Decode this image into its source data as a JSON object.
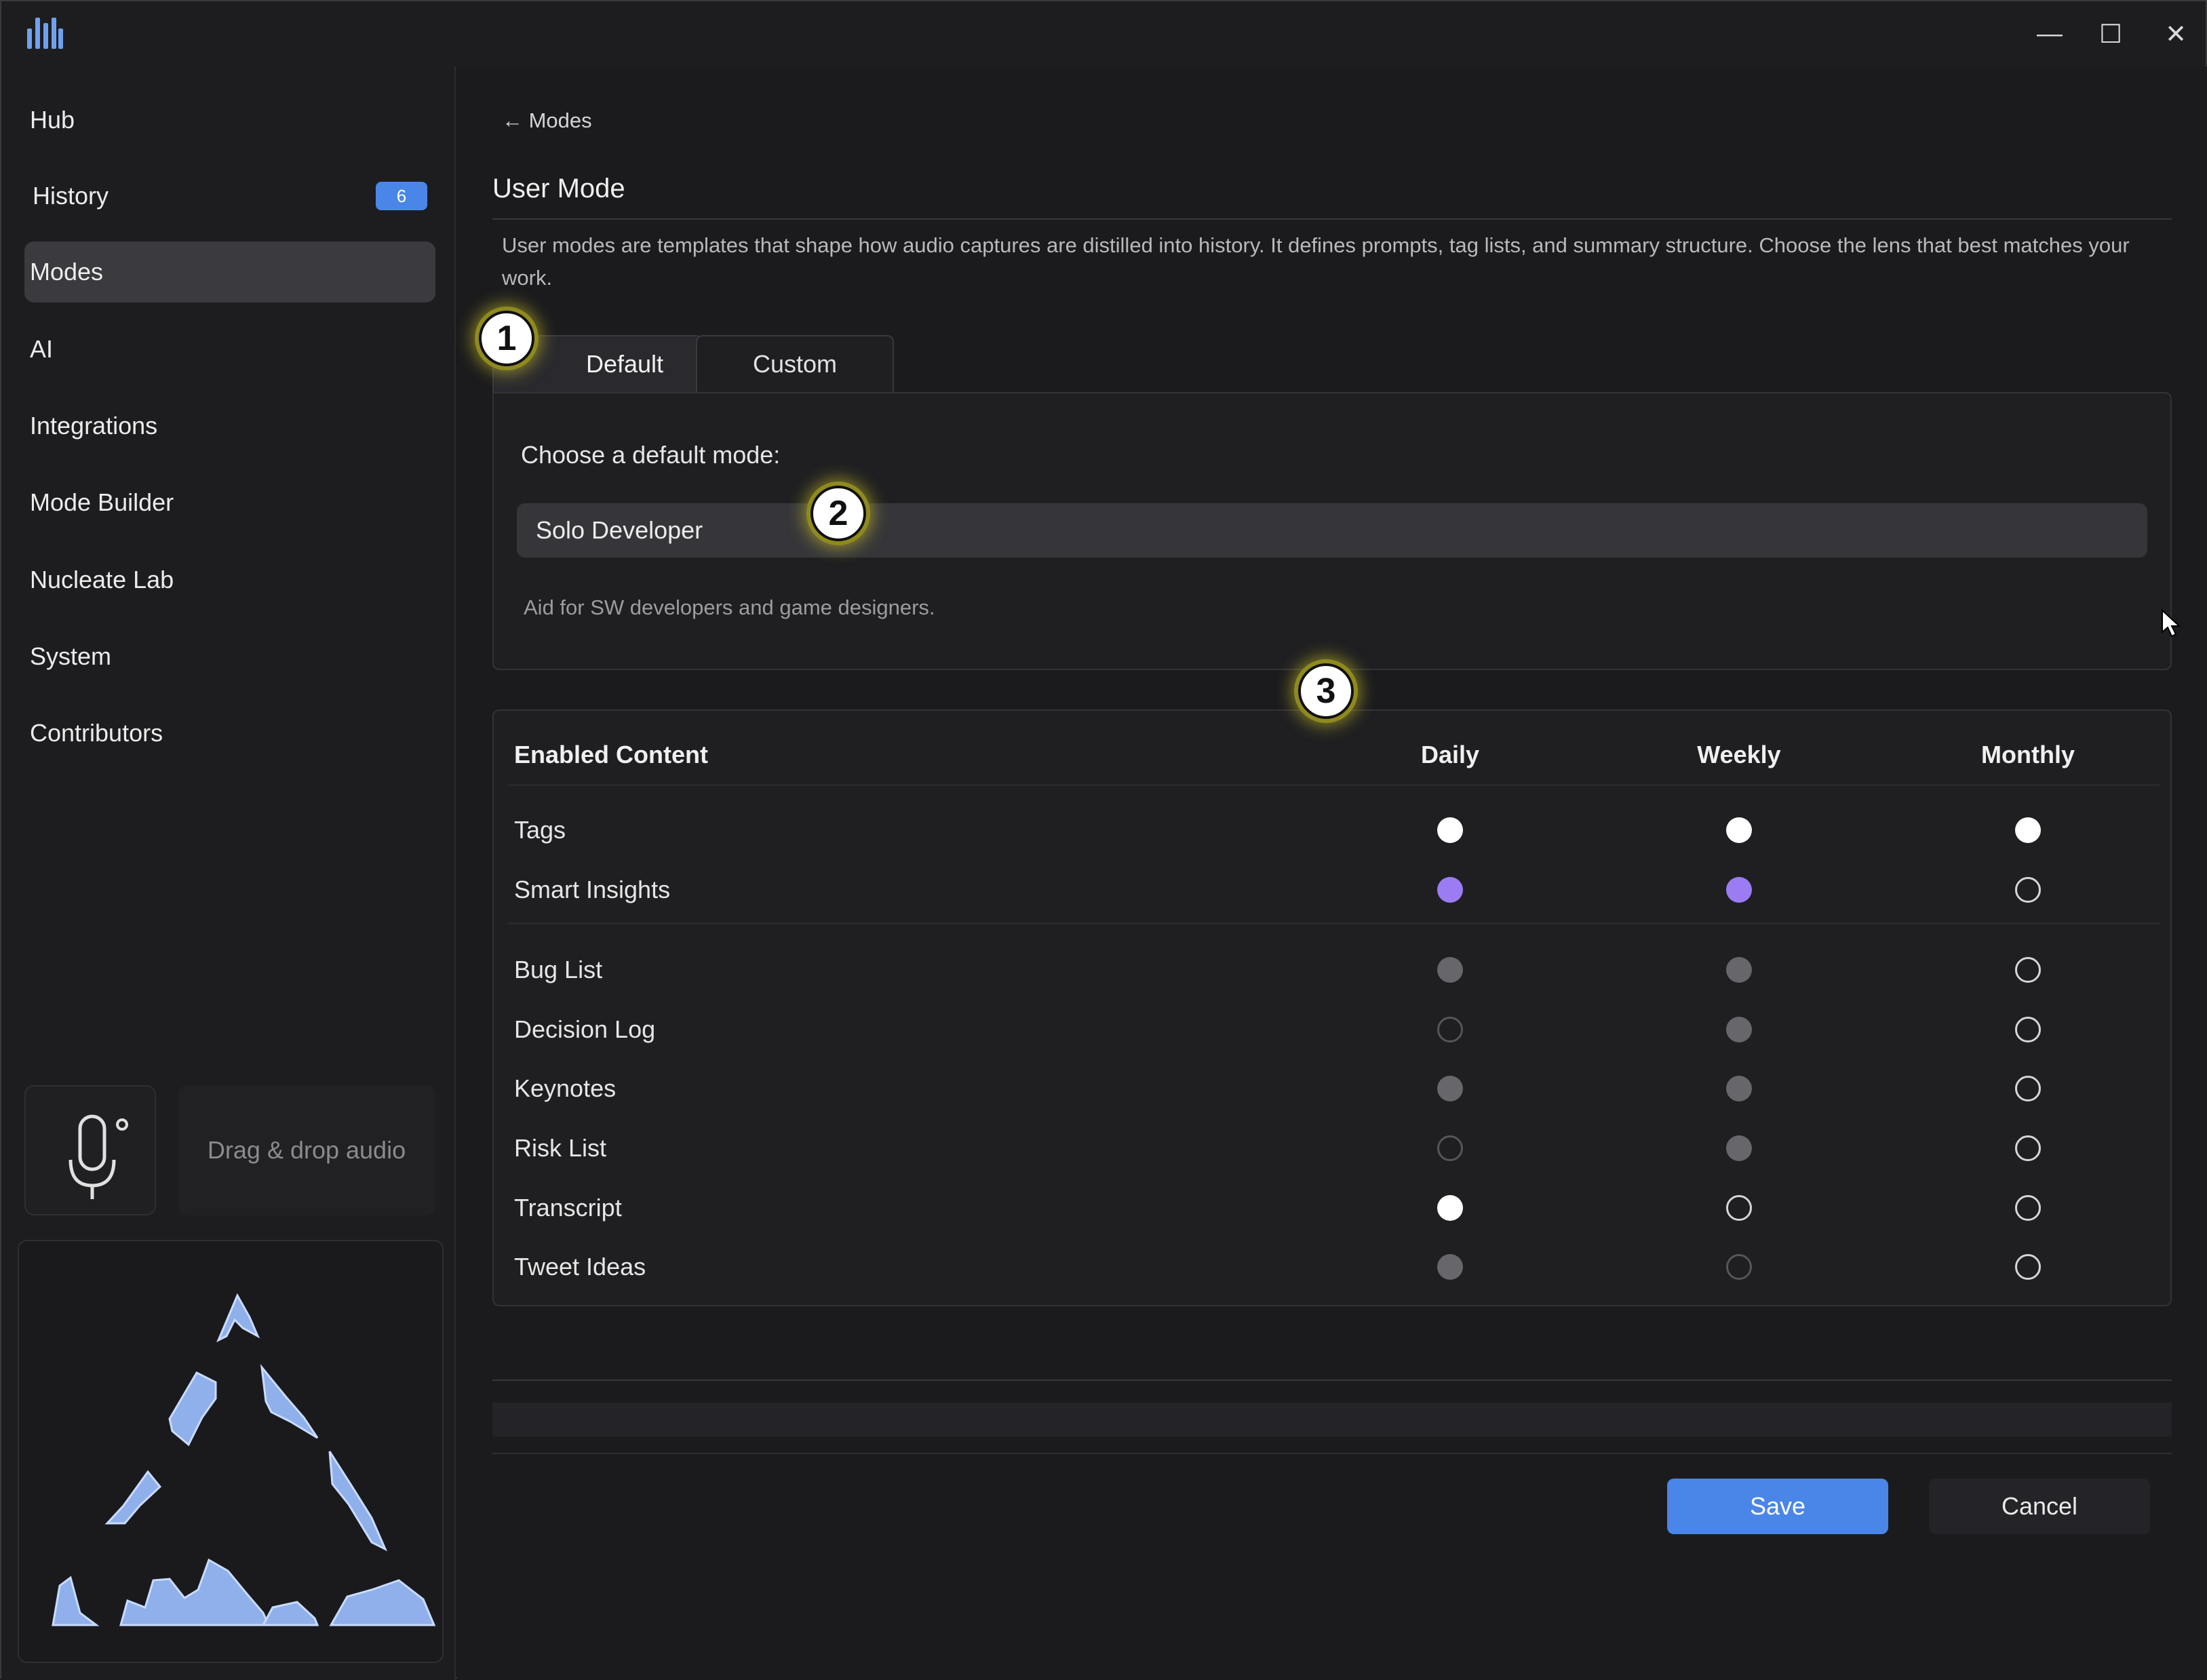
{
  "window": {
    "minimize_glyph": "—",
    "maximize_glyph": "☐",
    "close_glyph": "✕"
  },
  "sidebar": {
    "items": [
      {
        "label": "Hub"
      },
      {
        "label": "History",
        "badge": "6"
      },
      {
        "label": "Modes",
        "active": true
      },
      {
        "label": "AI"
      },
      {
        "label": "Integrations"
      },
      {
        "label": "Mode Builder"
      },
      {
        "label": "Nucleate Lab"
      },
      {
        "label": "System"
      },
      {
        "label": "Contributors"
      }
    ],
    "drop_label": "Drag & drop audio"
  },
  "main": {
    "back_link": "← Modes",
    "title": "User Mode",
    "description": "User modes are templates that shape how audio captures are distilled into history. It defines prompts, tag lists, and summary structure. Choose the lens that best matches your work.",
    "tabs": [
      {
        "label": "Default",
        "active": true
      },
      {
        "label": "Custom",
        "active": false
      }
    ],
    "panel": {
      "label": "Choose a default mode:",
      "selected_mode": "Solo Developer",
      "mode_description": "Aid for SW developers and game designers."
    },
    "table": {
      "headers": [
        "Enabled Content",
        "Daily",
        "Weekly",
        "Monthly"
      ],
      "rows": [
        {
          "label": "Tags",
          "states": [
            "white",
            "white",
            "white"
          ]
        },
        {
          "label": "Smart Insights",
          "states": [
            "purple",
            "purple",
            "outline"
          ]
        },
        {
          "label": "Bug List",
          "states": [
            "gray",
            "gray",
            "outline"
          ]
        },
        {
          "label": "Decision Log",
          "states": [
            "dim",
            "gray",
            "outline"
          ]
        },
        {
          "label": "Keynotes",
          "states": [
            "gray",
            "gray",
            "outline"
          ]
        },
        {
          "label": "Risk List",
          "states": [
            "dim",
            "gray",
            "outline"
          ]
        },
        {
          "label": "Transcript",
          "states": [
            "white",
            "outline",
            "outline"
          ]
        },
        {
          "label": "Tweet Ideas",
          "states": [
            "gray",
            "dim",
            "outline"
          ]
        }
      ]
    },
    "buttons": {
      "save": "Save",
      "cancel": "Cancel"
    }
  },
  "markers": [
    "1",
    "2",
    "3"
  ],
  "colors": {
    "accent": "#4a86e8",
    "selected_purple": "#9b7cf2",
    "background": "#1b1b1e"
  }
}
